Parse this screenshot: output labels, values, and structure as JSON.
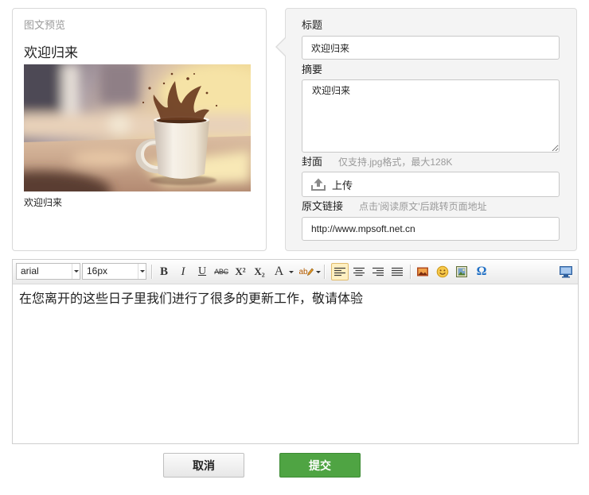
{
  "colors": {
    "submit_green": "#4fa443",
    "panel_bg": "#f4f4f4",
    "active_tool_bg": "#fff0c2",
    "special_chars_blue": "#1f6fc5"
  },
  "preview": {
    "header": "图文预览",
    "title": "欢迎归来",
    "caption": "欢迎归来"
  },
  "form": {
    "title": {
      "label": "标题",
      "value": "欢迎归来"
    },
    "summary": {
      "label": "摘要",
      "value": "欢迎归来"
    },
    "cover": {
      "label": "封面",
      "hint": "仅支持.jpg格式，最大128K",
      "upload_label": "上传",
      "upload_icon": "upload-icon"
    },
    "source_link": {
      "label": "原文链接",
      "hint": "点击'阅读原文'后跳转页面地址",
      "value": "http://www.mpsoft.net.cn"
    }
  },
  "editor": {
    "font_family": "arial",
    "font_size": "16px",
    "toolbar": {
      "bold": "B",
      "italic": "I",
      "underline": "U",
      "strikethrough": "ABC",
      "superscript": "X²",
      "subscript": "X₂",
      "font_color": "A",
      "highlight": "ab",
      "special_chars": "Ω"
    },
    "toolbar_icons": [
      "bold-icon",
      "italic-icon",
      "underline-icon",
      "strikethrough-icon",
      "superscript-icon",
      "subscript-icon",
      "font-color-icon",
      "highlight-icon",
      "align-left-icon",
      "align-center-icon",
      "align-right-icon",
      "align-justify-icon",
      "insert-image-icon",
      "emoji-icon",
      "insert-picture-icon",
      "special-chars-icon",
      "source-view-icon"
    ],
    "active_tool_icon": "align-left-icon",
    "content": "在您离开的这些日子里我们进行了很多的更新工作，敬请体验"
  },
  "actions": {
    "cancel": "取消",
    "submit": "提交"
  }
}
